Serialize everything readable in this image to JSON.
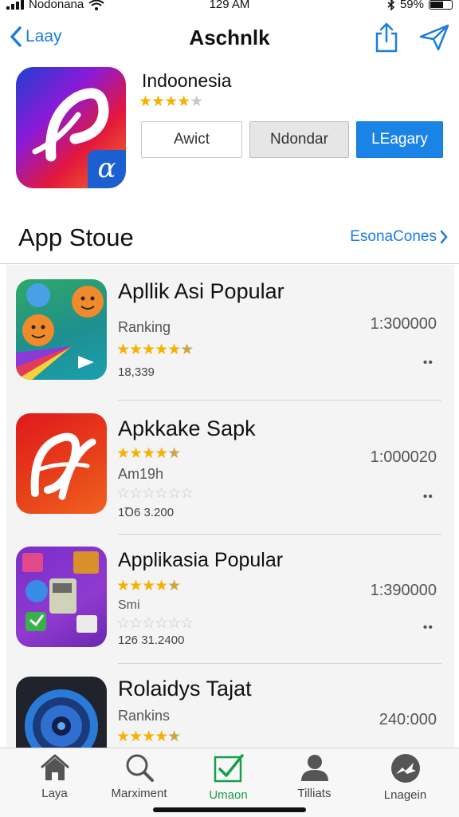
{
  "status_bar": {
    "carrier": "Nodonana",
    "time": "129 AM",
    "battery": "59%"
  },
  "nav": {
    "back_label": "Laay",
    "title": "Aschnlk"
  },
  "featured_app": {
    "name": "Indoonesia",
    "stars": "★★★★☆",
    "badge_glyph": "α",
    "buttons": [
      "Awict",
      "Ndondar",
      "LEagary"
    ]
  },
  "section": {
    "title": "App Stoue",
    "link": "EsonaCones"
  },
  "apps": [
    {
      "name": "Apllik Asi Popular",
      "sub": "Ranking",
      "stars": "★★★★☆",
      "rating_empty": "",
      "count": "18,339",
      "value": "1:300000",
      "more": "••"
    },
    {
      "name": "Apkkake Sapk",
      "sub": "Am19h",
      "stars": "★★★★☆",
      "rating_empty": "☆☆☆☆☆☆",
      "count": "1Ꝺ6 3.200",
      "value": "1:000020",
      "more": "••"
    },
    {
      "name": "Applikasia Popular",
      "sub": "Smi",
      "stars": "★★★★☆",
      "rating_empty": "☆☆☆☆☆☆",
      "count": "126 31.2400",
      "value": "1:390000",
      "more": "••"
    },
    {
      "name": "Rolaidys Tajat",
      "sub": "Rankins",
      "stars": "★★★★☆",
      "rating_empty": "",
      "count": "",
      "value": "240:000",
      "more": ""
    }
  ],
  "tabs": [
    {
      "label": "Laya",
      "icon": "home-icon"
    },
    {
      "label": "Marximent",
      "icon": "search-icon"
    },
    {
      "label": "Umaon",
      "icon": "checkbox-icon"
    },
    {
      "label": "Tilliats",
      "icon": "person-icon"
    },
    {
      "label": "Lnagein",
      "icon": "bird-icon"
    }
  ],
  "colors": {
    "accent": "#1a84e6",
    "active_tab": "#15a04a",
    "star": "#f6b100"
  }
}
